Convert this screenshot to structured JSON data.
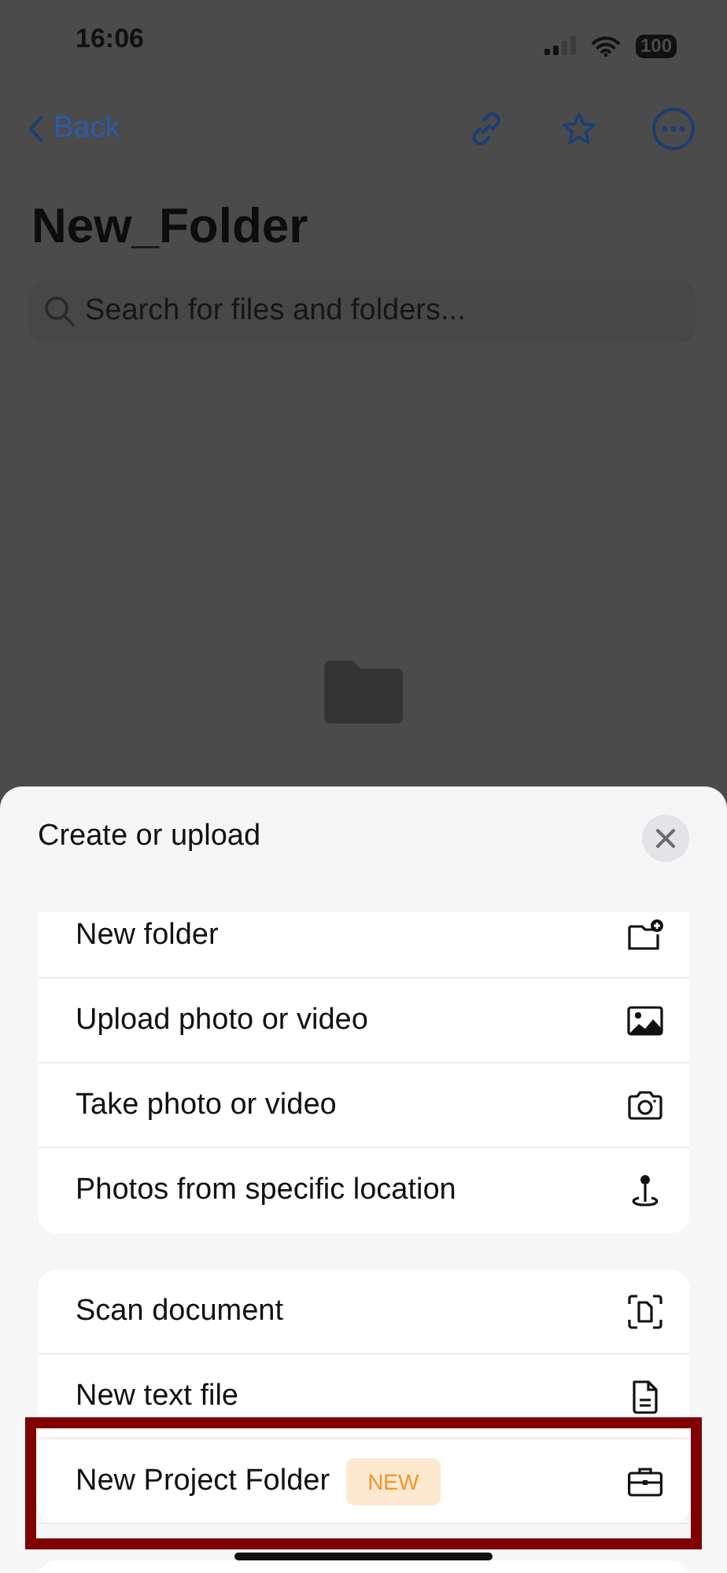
{
  "status_bar": {
    "time": "16:06",
    "battery": "100"
  },
  "nav": {
    "back": "Back"
  },
  "title": "New_Folder",
  "search": {
    "placeholder": "Search for files and folders..."
  },
  "sheet": {
    "title": "Create or upload",
    "groups": [
      {
        "items": [
          {
            "label": "New folder",
            "highlighted": false
          },
          {
            "label": "Upload photo or video",
            "highlighted": false
          },
          {
            "label": "Take photo or video",
            "highlighted": false
          },
          {
            "label": "Photos from specific location",
            "highlighted": false
          }
        ]
      },
      {
        "items": [
          {
            "label": "Scan document",
            "highlighted": false
          },
          {
            "label": "New text file",
            "highlighted": false
          },
          {
            "label": "New Project Folder",
            "badge": "NEW",
            "highlighted": true
          }
        ]
      }
    ]
  }
}
